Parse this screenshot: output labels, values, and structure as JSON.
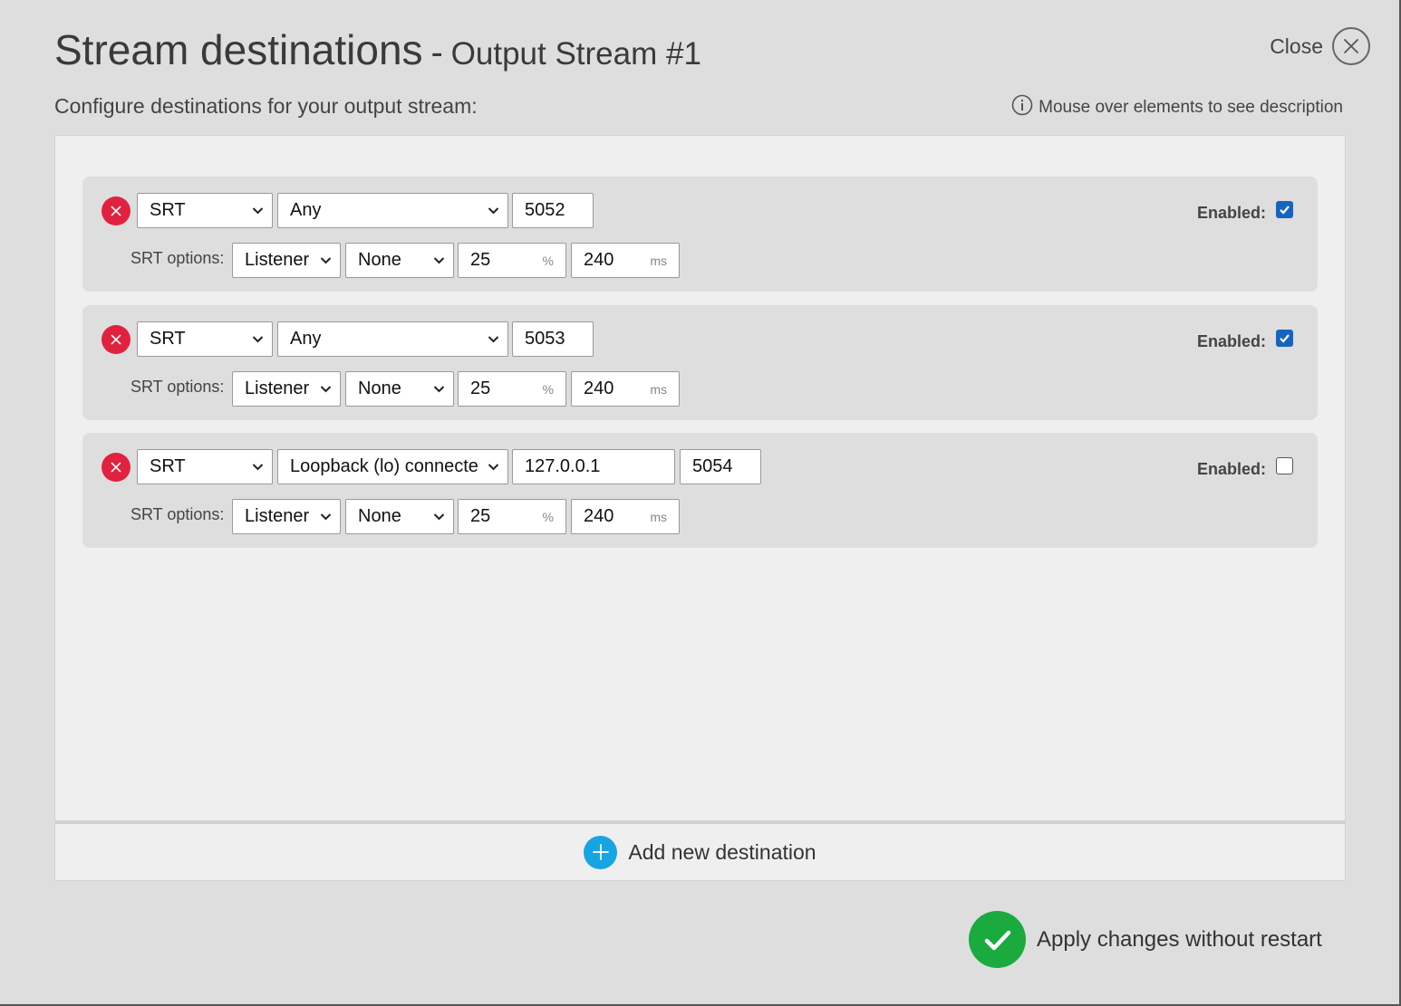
{
  "header": {
    "title": "Stream destinations",
    "separator": "-",
    "subtitle": "Output Stream #1",
    "close_label": "Close"
  },
  "description": "Configure destinations for your output stream:",
  "hint": "Mouse over elements to see description",
  "destinations": [
    {
      "protocol": "SRT",
      "interface": "Any",
      "address": "",
      "port": "5052",
      "enabled_label": "Enabled:",
      "enabled": true,
      "options_label": "SRT options:",
      "mode": "Listener",
      "encryption": "None",
      "overhead": "25",
      "overhead_unit": "%",
      "latency": "240",
      "latency_unit": "ms"
    },
    {
      "protocol": "SRT",
      "interface": "Any",
      "address": "",
      "port": "5053",
      "enabled_label": "Enabled:",
      "enabled": true,
      "options_label": "SRT options:",
      "mode": "Listener",
      "encryption": "None",
      "overhead": "25",
      "overhead_unit": "%",
      "latency": "240",
      "latency_unit": "ms"
    },
    {
      "protocol": "SRT",
      "interface": "Loopback (lo) connecte",
      "address": "127.0.0.1",
      "port": "5054",
      "enabled_label": "Enabled:",
      "enabled": false,
      "options_label": "SRT options:",
      "mode": "Listener",
      "encryption": "None",
      "overhead": "25",
      "overhead_unit": "%",
      "latency": "240",
      "latency_unit": "ms"
    }
  ],
  "add_label": "Add new destination",
  "apply_label": "Apply changes without restart",
  "colors": {
    "delete": "#e0223f",
    "add": "#17a4e3",
    "apply": "#1aaa3e",
    "checkbox": "#1565c0"
  }
}
